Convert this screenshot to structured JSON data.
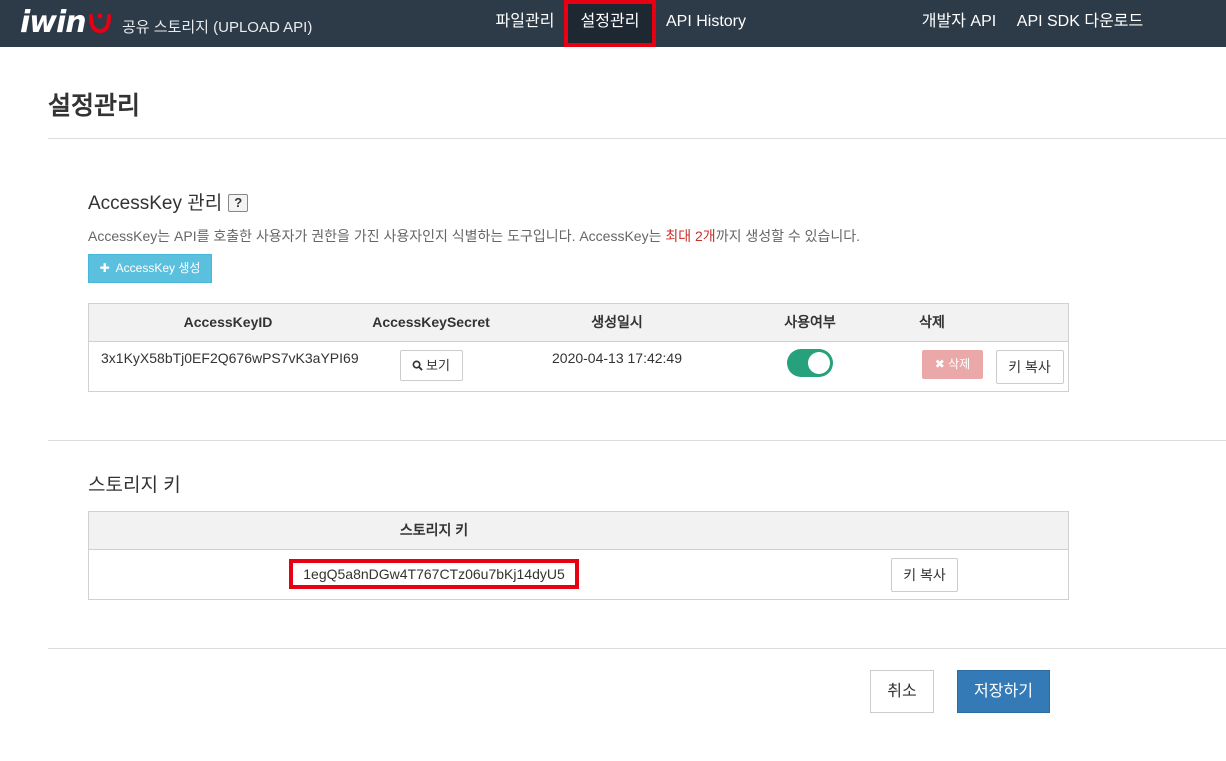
{
  "header": {
    "logo_text": "iwin",
    "app_title": "공유 스토리지 (UPLOAD API)",
    "nav": {
      "files": "파일관리",
      "settings": "설정관리",
      "history": "API History",
      "dev_api": "개발자 API",
      "sdk": "API SDK 다운로드"
    }
  },
  "page": {
    "title": "설정관리"
  },
  "accesskey": {
    "title": "AccessKey 관리",
    "help": "?",
    "desc_before": "AccessKey는 API를 호출한 사용자가 권한을 가진 사용자인지 식별하는 도구입니다. AccessKey는 ",
    "desc_highlight": "최대 2개",
    "desc_after": "까지 생성할 수 있습니다.",
    "create_button": "AccessKey 생성",
    "columns": {
      "id": "AccessKeyID",
      "secret": "AccessKeySecret",
      "created": "생성일시",
      "enabled": "사용여부",
      "delete": "삭제"
    },
    "rows": [
      {
        "id": "3x1KyX58bTj0EF2Q676wPS7vK3aYPI69",
        "view_button": "보기",
        "created": "2020-04-13 17:42:49",
        "enabled": true,
        "delete_button": "삭제",
        "copy_button": "키 복사"
      }
    ]
  },
  "storage": {
    "title": "스토리지 키",
    "column": "스토리지 키",
    "key": "1egQ5a8nDGw4T767CTz06u7bKj14dyU5",
    "copy_button": "키 복사"
  },
  "footer": {
    "cancel": "취소",
    "save": "저장하기"
  },
  "colors": {
    "topbar": "#2d3a47",
    "highlight": "#e60012",
    "primary": "#337ab7",
    "info": "#5bc0de",
    "toggle_on": "#26a17b"
  }
}
